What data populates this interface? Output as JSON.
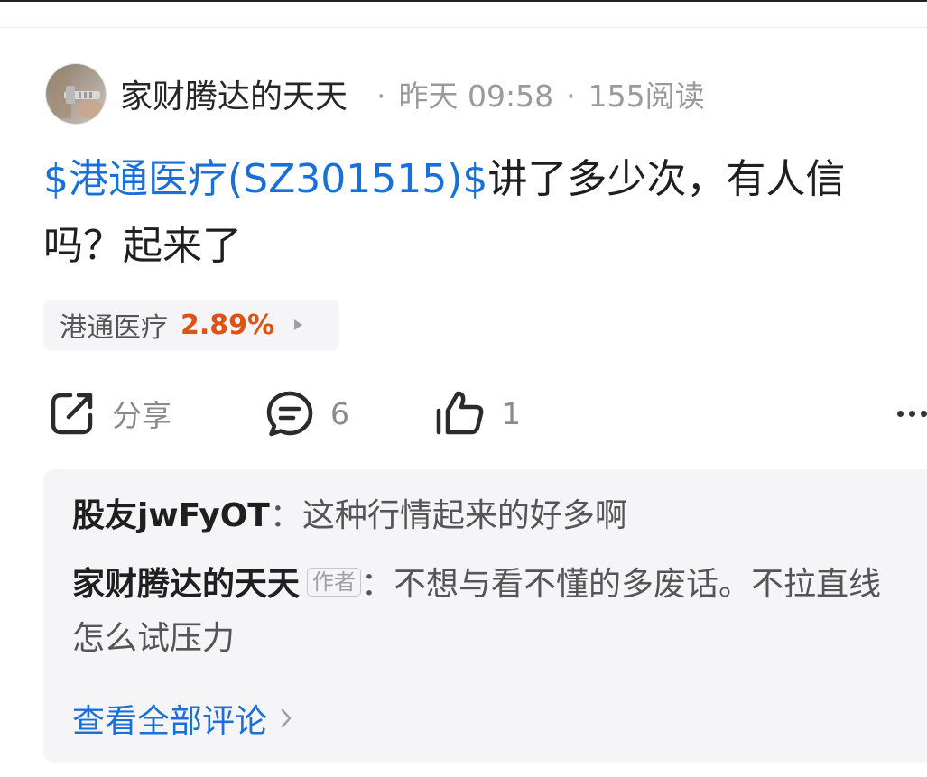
{
  "post": {
    "author": "家财腾达的天天",
    "time": "昨天 09:58",
    "reads": "155阅读",
    "stock_link": "$港通医疗(SZ301515)$",
    "text": "讲了多少次，有人信吗？起来了",
    "stock_chip": {
      "name": "港通医疗",
      "change": "2.89%"
    }
  },
  "actions": {
    "share_label": "分享",
    "comment_count": "6",
    "like_count": "1"
  },
  "comments": {
    "items": [
      {
        "user": "股友jwFyOT",
        "separator": "：",
        "text": "这种行情起来的好多啊"
      },
      {
        "user": "家财腾达的天天",
        "tag": "作者",
        "separator": "：",
        "text": "不想与看不懂的多废话。不拉直线怎么试压力"
      }
    ],
    "view_all_label": "查看全部评论"
  },
  "colors": {
    "link_blue": "#1a70d9",
    "rise_orange": "#e05213",
    "panel_gray": "#f5f5f7"
  },
  "icons": [
    "avatar-photo",
    "share-icon",
    "comment-icon",
    "thumbs-up-icon",
    "more-icon",
    "chevron-right-icon"
  ]
}
